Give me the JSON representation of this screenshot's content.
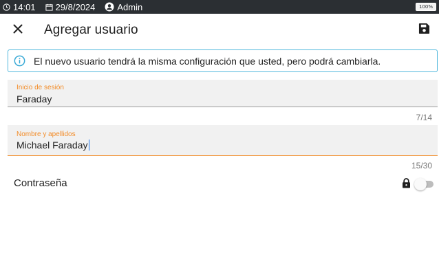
{
  "status_bar": {
    "time": "14:01",
    "date": "29/8/2024",
    "user": "Admin",
    "battery": "100%",
    "icons": [
      "clock-icon",
      "calendar-icon",
      "user-circle-icon",
      "battery-icon"
    ]
  },
  "app_bar": {
    "title": "Agregar usuario",
    "icons": [
      "close-icon",
      "save-icon"
    ]
  },
  "info_banner": {
    "text": "El nuevo usuario tendrá la misma configuración que usted, pero podrá cambiarla.",
    "icon": "info-icon",
    "color": "#4fb7dc"
  },
  "form": {
    "login": {
      "label": "Inicio de sesión",
      "value": "Faraday",
      "counter": "7/14"
    },
    "full_name": {
      "label": "Nombre y apellidos",
      "value": "Michael Faraday",
      "counter": "15/30"
    },
    "password": {
      "label": "Contraseña",
      "icon": "lock-icon",
      "enabled": false
    }
  },
  "colors": {
    "accent": "#f28c28",
    "status_bar": "#2b2f33",
    "info_border": "#4fb7dc"
  }
}
